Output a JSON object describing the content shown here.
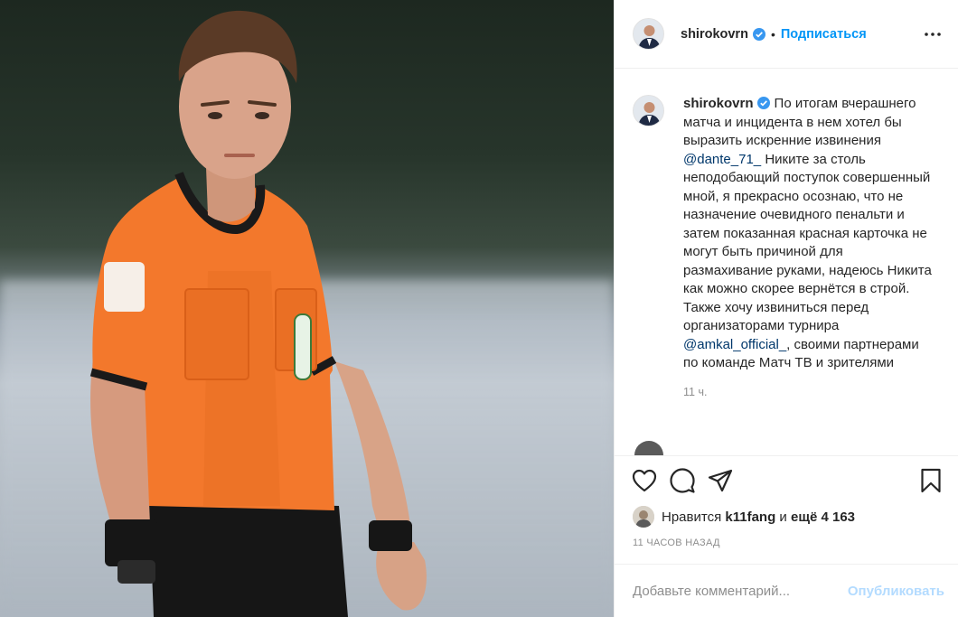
{
  "post": {
    "username": "shirokovrn",
    "follow_label": "Подписаться",
    "dot": "•",
    "caption_username": "shirokovrn",
    "caption_part1": "По итогам вчерашнего матча и инцидента в нем хотел бы выразить искренние извинения",
    "mention1": "@dante_71_",
    "caption_part2": "Никите за столь неподобающий поступок совершенный мной, я прекрасно осознаю, что не назначение очевидного пенальти и затем показанная красная карточка не могут быть причиной для размахивание руками, надеюсь Никита как можно скорее вернётся в строй. Также хочу извиниться перед организаторами турнира",
    "mention2": "@amkal_official_",
    "caption_part3": ", своими партнерами по команде Матч ТВ и зрителями",
    "caption_time": "11 ч.",
    "likes_prefix": "Нравится",
    "likes_user": "k11fang",
    "likes_and": "и",
    "likes_more": "ещё 4 163",
    "posted_ago": "11 часов назад",
    "comment_placeholder": "Добавьте комментарий...",
    "publish_label": "Опубликовать"
  },
  "icons": [
    "verified-badge-icon",
    "more-options-icon",
    "heart-icon",
    "comment-icon",
    "share-icon",
    "bookmark-icon"
  ],
  "colors": {
    "accent": "#0095f6",
    "mention": "#00376b",
    "muted": "#8e8e8e",
    "jersey": "#f3782c"
  }
}
